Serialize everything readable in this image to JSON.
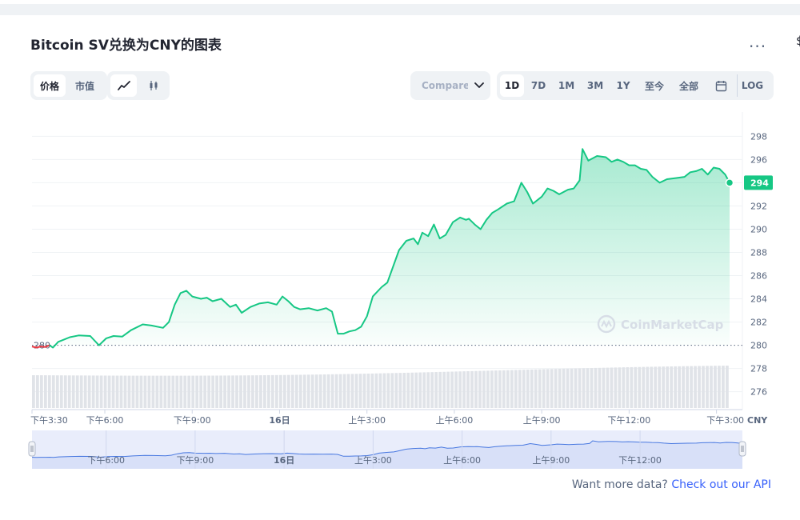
{
  "page": {
    "title": "Bitcoin SV兑换为CNY的图表",
    "more_label": "...",
    "edge_char": "$",
    "metric_tabs": [
      {
        "label": "价格",
        "active": true
      },
      {
        "label": "市值",
        "active": false
      }
    ],
    "chart_style_icons": [
      "line-chart-icon",
      "candlestick-icon"
    ],
    "compare_label": "Compare with",
    "range_tabs": [
      {
        "label": "1D",
        "active": true
      },
      {
        "label": "7D",
        "active": false
      },
      {
        "label": "1M",
        "active": false
      },
      {
        "label": "3M",
        "active": false
      },
      {
        "label": "1Y",
        "active": false
      },
      {
        "label": "至今",
        "active": false
      },
      {
        "label": "全部",
        "active": false
      }
    ],
    "log_label": "LOG",
    "footer_text": "Want more data?",
    "footer_link": "Check out our API"
  },
  "chart_data": {
    "type": "area",
    "currency_label": "CNY",
    "watermark": "CoinMarketCap",
    "baseline_value": 280,
    "current_value": 294,
    "y_ticks": [
      276,
      278,
      280,
      282,
      284,
      286,
      288,
      290,
      292,
      294,
      296,
      298
    ],
    "y_range": [
      274.6,
      299.4
    ],
    "x_ticks": [
      "下午3:30",
      "下午6:00",
      "下午9:00",
      "16日",
      "上午3:00",
      "上午6:00",
      "上午9:00",
      "下午12:00",
      "下午3:00"
    ],
    "x_tick_positions": [
      0,
      2.5,
      5.5,
      8.5,
      11.5,
      14.5,
      17.5,
      20.5,
      23.5
    ],
    "navigator_ticks": [
      "下午6:00",
      "下午9:00",
      "16日",
      "上午3:00",
      "上午6:00",
      "上午9:00",
      "下午12:00"
    ],
    "navigator_tick_positions": [
      2.5,
      5.5,
      8.5,
      11.5,
      14.5,
      17.5,
      20.5
    ],
    "x_range": [
      0,
      23.95
    ],
    "colors": {
      "up": "#16c784",
      "down": "#ea3943",
      "navigator": "#4878e0",
      "volume": "#e0e3e8"
    },
    "series": [
      {
        "values": [
          [
            0.0,
            279.9
          ],
          [
            0.15,
            279.8
          ],
          [
            0.3,
            279.9
          ],
          [
            0.45,
            279.85
          ],
          [
            0.6,
            280.0
          ],
          [
            0.72,
            279.8
          ],
          [
            0.9,
            280.3
          ],
          [
            1.1,
            280.5
          ],
          [
            1.3,
            280.7
          ],
          [
            1.6,
            280.85
          ],
          [
            2.0,
            280.8
          ],
          [
            2.3,
            280.0
          ],
          [
            2.55,
            280.6
          ],
          [
            2.8,
            280.8
          ],
          [
            3.1,
            280.75
          ],
          [
            3.4,
            281.3
          ],
          [
            3.8,
            281.8
          ],
          [
            4.1,
            281.7
          ],
          [
            4.5,
            281.5
          ],
          [
            4.7,
            282.0
          ],
          [
            4.9,
            283.5
          ],
          [
            5.1,
            284.5
          ],
          [
            5.3,
            284.7
          ],
          [
            5.5,
            284.2
          ],
          [
            5.8,
            284.0
          ],
          [
            6.0,
            284.1
          ],
          [
            6.2,
            283.8
          ],
          [
            6.5,
            284.0
          ],
          [
            6.8,
            283.3
          ],
          [
            7.0,
            283.5
          ],
          [
            7.2,
            282.8
          ],
          [
            7.5,
            283.3
          ],
          [
            7.8,
            283.6
          ],
          [
            8.1,
            283.7
          ],
          [
            8.4,
            283.5
          ],
          [
            8.6,
            284.2
          ],
          [
            8.8,
            283.8
          ],
          [
            9.0,
            283.3
          ],
          [
            9.2,
            283.1
          ],
          [
            9.5,
            283.2
          ],
          [
            9.8,
            283.0
          ],
          [
            10.1,
            283.2
          ],
          [
            10.3,
            282.9
          ],
          [
            10.5,
            281.0
          ],
          [
            10.7,
            281.0
          ],
          [
            10.9,
            281.2
          ],
          [
            11.1,
            281.3
          ],
          [
            11.3,
            281.6
          ],
          [
            11.5,
            282.5
          ],
          [
            11.7,
            284.2
          ],
          [
            12.0,
            285.0
          ],
          [
            12.2,
            285.4
          ],
          [
            12.4,
            286.8
          ],
          [
            12.6,
            288.2
          ],
          [
            12.85,
            289.0
          ],
          [
            13.1,
            289.2
          ],
          [
            13.25,
            288.7
          ],
          [
            13.4,
            289.7
          ],
          [
            13.6,
            289.4
          ],
          [
            13.8,
            290.4
          ],
          [
            14.0,
            289.2
          ],
          [
            14.2,
            289.5
          ],
          [
            14.45,
            290.6
          ],
          [
            14.7,
            291.0
          ],
          [
            14.9,
            290.8
          ],
          [
            15.0,
            290.9
          ],
          [
            15.2,
            290.4
          ],
          [
            15.4,
            290.0
          ],
          [
            15.6,
            290.8
          ],
          [
            15.8,
            291.4
          ],
          [
            16.0,
            291.7
          ],
          [
            16.3,
            292.2
          ],
          [
            16.55,
            292.4
          ],
          [
            16.8,
            294.0
          ],
          [
            17.0,
            293.2
          ],
          [
            17.2,
            292.2
          ],
          [
            17.5,
            292.8
          ],
          [
            17.7,
            293.5
          ],
          [
            17.9,
            293.3
          ],
          [
            18.1,
            293.0
          ],
          [
            18.4,
            293.4
          ],
          [
            18.6,
            293.5
          ],
          [
            18.8,
            294.2
          ],
          [
            18.9,
            296.9
          ],
          [
            19.1,
            295.9
          ],
          [
            19.4,
            296.3
          ],
          [
            19.7,
            296.2
          ],
          [
            19.9,
            295.8
          ],
          [
            20.1,
            296.0
          ],
          [
            20.3,
            295.8
          ],
          [
            20.5,
            295.5
          ],
          [
            20.7,
            295.5
          ],
          [
            20.9,
            295.2
          ],
          [
            21.1,
            295.1
          ],
          [
            21.3,
            294.5
          ],
          [
            21.55,
            294.0
          ],
          [
            21.8,
            294.3
          ],
          [
            22.1,
            294.4
          ],
          [
            22.4,
            294.5
          ],
          [
            22.6,
            294.9
          ],
          [
            22.8,
            295.0
          ],
          [
            23.0,
            295.2
          ],
          [
            23.2,
            294.7
          ],
          [
            23.4,
            295.3
          ],
          [
            23.6,
            295.2
          ],
          [
            23.8,
            294.7
          ],
          [
            23.95,
            294.0
          ]
        ]
      }
    ]
  }
}
